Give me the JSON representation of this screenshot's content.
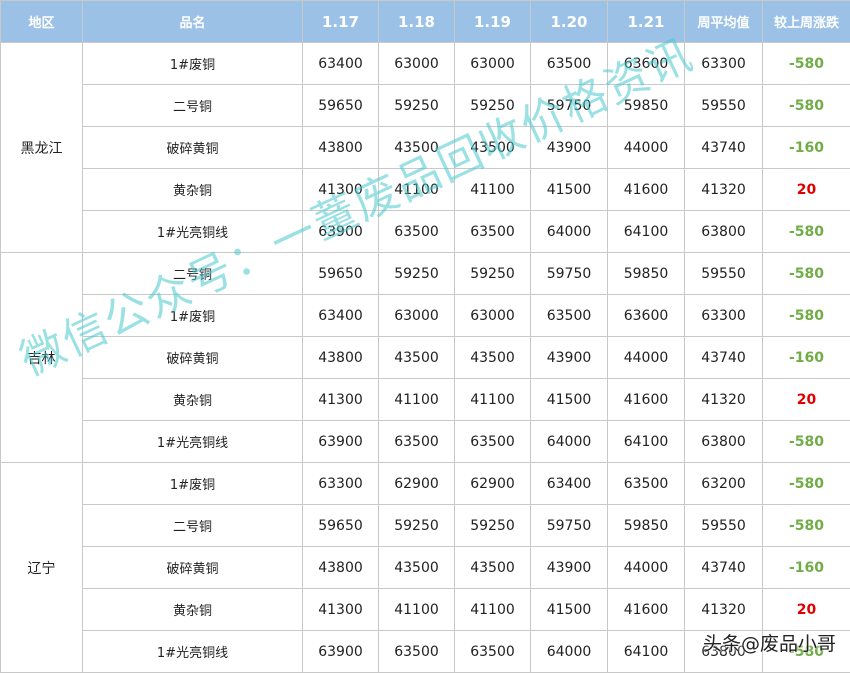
{
  "table": {
    "headers": [
      "地区",
      "品名",
      "1.17",
      "1.18",
      "1.19",
      "1.20",
      "1.21",
      "周平均值",
      "较上周涨跌"
    ],
    "regions": [
      {
        "name": "黑龙江",
        "rows": [
          {
            "item": "1#废铜",
            "values": [
              "63400",
              "63000",
              "63000",
              "63500",
              "63600",
              "63300"
            ],
            "change": "-580",
            "dir": "down"
          },
          {
            "item": "二号铜",
            "values": [
              "59650",
              "59250",
              "59250",
              "59750",
              "59850",
              "59550"
            ],
            "change": "-580",
            "dir": "down"
          },
          {
            "item": "破碎黄铜",
            "values": [
              "43800",
              "43500",
              "43500",
              "43900",
              "44000",
              "43740"
            ],
            "change": "-160",
            "dir": "down"
          },
          {
            "item": "黄杂铜",
            "values": [
              "41300",
              "41100",
              "41100",
              "41500",
              "41600",
              "41320"
            ],
            "change": "20",
            "dir": "up"
          },
          {
            "item": "1#光亮铜线",
            "values": [
              "63900",
              "63500",
              "63500",
              "64000",
              "64100",
              "63800"
            ],
            "change": "-580",
            "dir": "down"
          }
        ]
      },
      {
        "name": "吉林",
        "rows": [
          {
            "item": "二号铜",
            "values": [
              "59650",
              "59250",
              "59250",
              "59750",
              "59850",
              "59550"
            ],
            "change": "-580",
            "dir": "down"
          },
          {
            "item": "1#废铜",
            "values": [
              "63400",
              "63000",
              "63000",
              "63500",
              "63600",
              "63300"
            ],
            "change": "-580",
            "dir": "down"
          },
          {
            "item": "破碎黄铜",
            "values": [
              "43800",
              "43500",
              "43500",
              "43900",
              "44000",
              "43740"
            ],
            "change": "-160",
            "dir": "down"
          },
          {
            "item": "黄杂铜",
            "values": [
              "41300",
              "41100",
              "41100",
              "41500",
              "41600",
              "41320"
            ],
            "change": "20",
            "dir": "up"
          },
          {
            "item": "1#光亮铜线",
            "values": [
              "63900",
              "63500",
              "63500",
              "64000",
              "64100",
              "63800"
            ],
            "change": "-580",
            "dir": "down"
          }
        ]
      },
      {
        "name": "辽宁",
        "rows": [
          {
            "item": "1#废铜",
            "values": [
              "63300",
              "62900",
              "62900",
              "63400",
              "63500",
              "63200"
            ],
            "change": "-580",
            "dir": "down"
          },
          {
            "item": "二号铜",
            "values": [
              "59650",
              "59250",
              "59250",
              "59750",
              "59850",
              "59550"
            ],
            "change": "-580",
            "dir": "down"
          },
          {
            "item": "破碎黄铜",
            "values": [
              "43800",
              "43500",
              "43500",
              "43900",
              "44000",
              "43740"
            ],
            "change": "-160",
            "dir": "down"
          },
          {
            "item": "黄杂铜",
            "values": [
              "41300",
              "41100",
              "41100",
              "41500",
              "41600",
              "41320"
            ],
            "change": "20",
            "dir": "up"
          },
          {
            "item": "1#光亮铜线",
            "values": [
              "63900",
              "63500",
              "63500",
              "64000",
              "64100",
              "63800"
            ],
            "change": "-580",
            "dir": "down"
          }
        ]
      }
    ]
  },
  "watermark": "微信公众号：一蕫废品回收价格资讯",
  "footer_mark": "头条@废品小哥",
  "colors": {
    "header_bg": "#9bc2e6",
    "down": "#70ad47",
    "up": "#e00000",
    "watermark": "#48c8cd"
  }
}
